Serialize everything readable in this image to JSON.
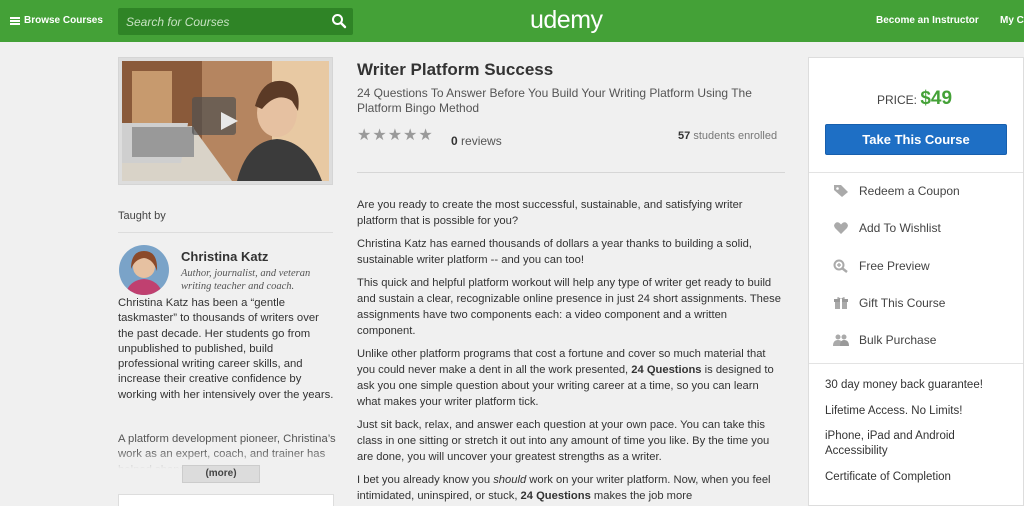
{
  "header": {
    "browse_label": "Browse Courses",
    "search_placeholder": "Search for Courses",
    "logo": "udemy",
    "become_instructor": "Become an Instructor",
    "my_courses": "My C"
  },
  "course": {
    "title": "Writer Platform Success",
    "subtitle": "24 Questions To Answer Before You Build Your Writing Platform Using The Platform Bingo Method",
    "rating": 0,
    "reviews_count": "0",
    "reviews_label": "reviews",
    "students_count": "57",
    "students_label": "students enrolled"
  },
  "instructor": {
    "taught_by": "Taught by",
    "name": "Christina Katz",
    "tagline": "Author, journalist, and veteran writing teacher and coach.",
    "bio_1": "Christina Katz has been a “gentle taskmaster” to thousands of writers over the past decade. Her students go from unpublished to published, build professional writing career skills, and increase their creative confidence by working with her intensively over the years.",
    "bio_2": "A platform development pioneer, Christina’s work as an expert, coach, and trainer has helped shape the concept",
    "more_label": "(more)"
  },
  "description": {
    "p1": "Are you ready to create the most successful, sustainable, and satisfying writer platform that is possible for you?",
    "p2": "Christina Katz has earned thousands of dollars a year thanks to building a solid, sustainable writer platform -- and you can too!",
    "p3": "This quick and helpful platform workout will help any type of writer get ready to build and sustain a clear, recognizable online presence in just 24 short assignments. These assignments have two components each: a video component and a written component.",
    "p4_a": "Unlike other platform programs that cost a fortune and cover so much material that you could never make a dent in all the work presented, ",
    "p4_b": "24 Questions",
    "p4_c": " is designed to ask you one simple question about your writing career at a time, so you can learn what makes your writer platform tick.",
    "p5": "Just sit back, relax, and answer each question at your own pace. You can take this class in one sitting or stretch it out into any amount of time you like. By the time you are done, you will uncover your greatest strengths as a writer.",
    "p6_a": "I bet you already know you ",
    "p6_b": "should",
    "p6_c": " work on your writer platform. Now, when you feel intimidated, uninspired, or stuck, ",
    "p6_d": "24 Questions",
    "p6_e": " makes the job more"
  },
  "sidebar": {
    "price_label": "PRICE:",
    "price_value": "$49",
    "take_button": "Take This Course",
    "items": [
      {
        "label": "Redeem a Coupon",
        "icon": "tag-icon"
      },
      {
        "label": "Add To Wishlist",
        "icon": "heart-icon"
      },
      {
        "label": "Free Preview",
        "icon": "magnifier-icon"
      },
      {
        "label": "Gift This Course",
        "icon": "gift-icon"
      },
      {
        "label": "Bulk Purchase",
        "icon": "users-icon"
      }
    ],
    "features": [
      "30 day money back guarantee!",
      "Lifetime Access. No Limits!",
      "iPhone, iPad and Android Accessibility",
      "Certificate of Completion"
    ]
  },
  "colors": {
    "brand_green": "#44a137",
    "search_green": "#2f8426",
    "button_blue": "#1e6fc5",
    "price_green": "#44a137"
  }
}
